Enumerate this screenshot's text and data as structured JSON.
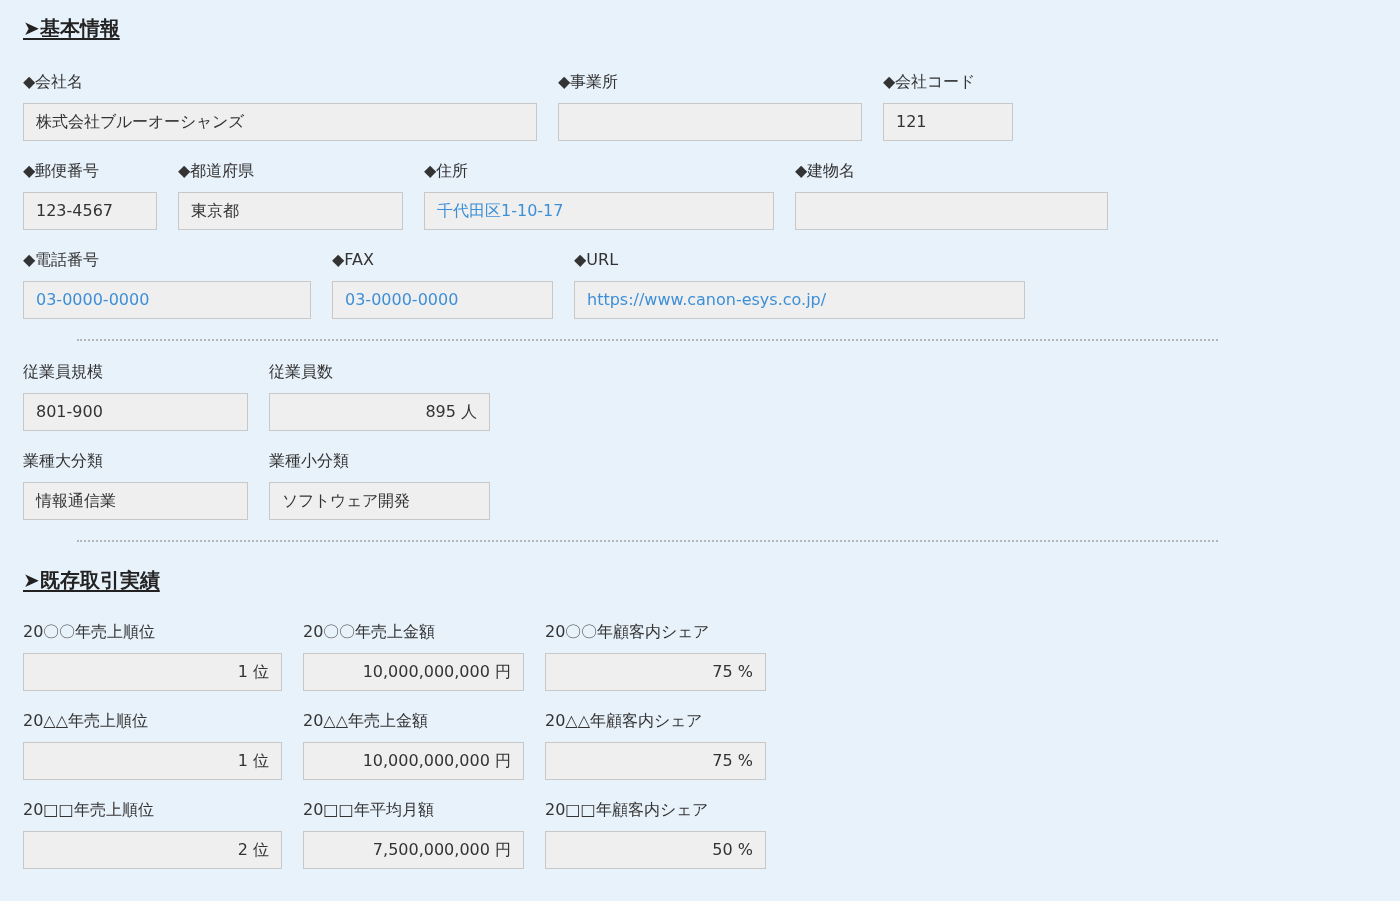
{
  "sections": [
    {
      "title": "➤基本情報",
      "parts": [
        {
          "kind": "rows",
          "rows": [
            [
              {
                "label": "◆会社名",
                "value": "株式会社ブルーオーシャンズ",
                "kind": "text"
              },
              {
                "label": "◆事業所",
                "kind": "text"
              },
              {
                "label": "◆会社コード",
                "value": "121",
                "kind": "text"
              }
            ],
            [
              {
                "label": "◆郵便番号",
                "value": "123-4567",
                "kind": "text"
              },
              {
                "label": "◆都道府県",
                "value": "東京都",
                "kind": "text"
              },
              {
                "label": "◆住所",
                "value": "千代田区1-10-17",
                "kind": "link"
              },
              {
                "label": "◆建物名",
                "kind": "text"
              }
            ],
            [
              {
                "label": "◆電話番号",
                "value": "03-0000-0000",
                "kind": "link"
              },
              {
                "label": "◆FAX",
                "value": "03-0000-0000",
                "kind": "link"
              },
              {
                "label": "◆URL",
                "value": "https://www.canon-esys.co.jp/",
                "kind": "link"
              }
            ]
          ]
        },
        {
          "kind": "divider"
        },
        {
          "kind": "rows",
          "rows": [
            [
              {
                "label": "従業員規模",
                "value": "801-900",
                "kind": "text"
              },
              {
                "label": "従業員数",
                "value": "895 人",
                "kind": "amount"
              }
            ],
            [
              {
                "label": "業種大分類",
                "value": "情報通信業",
                "kind": "text"
              },
              {
                "label": "業種小分類",
                "value": "ソフトウェア開発",
                "kind": "text"
              }
            ]
          ]
        },
        {
          "kind": "divider"
        }
      ]
    },
    {
      "title": "➤既存取引実績",
      "parts": [
        {
          "kind": "rows",
          "rows": [
            [
              {
                "label": "20〇〇年売上順位",
                "value": "1 位",
                "kind": "amount"
              },
              {
                "label": "20〇〇年売上金額",
                "value": "10,000,000,000 円",
                "kind": "amount"
              },
              {
                "label": "20〇〇年顧客内シェア",
                "value": "75 %",
                "kind": "amount"
              }
            ],
            [
              {
                "label": "20△△年売上順位",
                "value": "1 位",
                "kind": "amount"
              },
              {
                "label": "20△△年売上金額",
                "value": "10,000,000,000 円",
                "kind": "amount"
              },
              {
                "label": "20△△年顧客内シェア",
                "value": "75 %",
                "kind": "amount"
              }
            ],
            [
              {
                "label": "20□□年売上順位",
                "value": "2 位",
                "kind": "amount"
              },
              {
                "label": "20□□年平均月額",
                "value": "7,500,000,000 円",
                "kind": "amount"
              },
              {
                "label": "20□□年顧客内シェア",
                "value": "50 %",
                "kind": "amount"
              }
            ]
          ]
        }
      ]
    }
  ]
}
